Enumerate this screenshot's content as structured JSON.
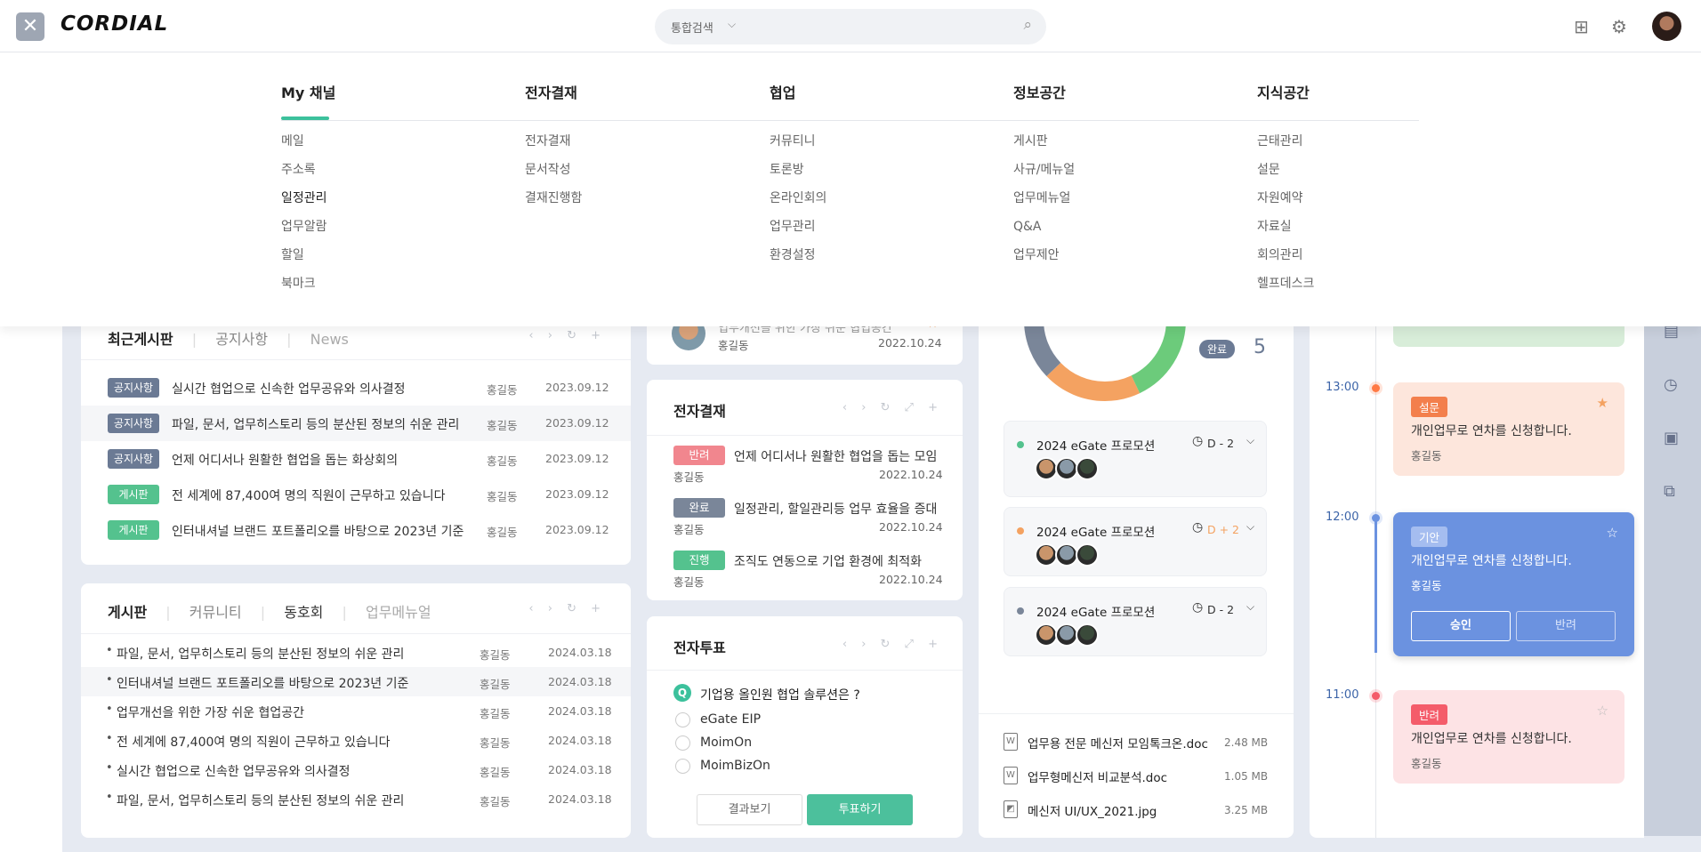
{
  "header": {
    "close_icon": "✕",
    "logo": "CORDIAL",
    "search_scope": "통합검색",
    "search_placeholder": ""
  },
  "menu": [
    {
      "title": "My 채널",
      "items": [
        "메일",
        "주소록",
        "일정관리",
        "업무알람",
        "할일",
        "북마크"
      ]
    },
    {
      "title": "전자결재",
      "items": [
        "전자결재",
        "문서작성",
        "결재진행함"
      ]
    },
    {
      "title": "협업",
      "items": [
        "커뮤티니",
        "토론방",
        "온라인회의",
        "업무관리",
        "환경설정"
      ]
    },
    {
      "title": "정보공간",
      "items": [
        "게시판",
        "사규/메뉴얼",
        "업무메뉴얼",
        "Q&A",
        "업무제안"
      ]
    },
    {
      "title": "지식공간",
      "items": [
        "근태관리",
        "설문",
        "자원예약",
        "자료실",
        "회의관리",
        "헬프데스크"
      ]
    }
  ],
  "recent": {
    "tabs": [
      "최근게시판",
      "공지사항",
      "News"
    ],
    "rows": [
      {
        "badge": "공지사항",
        "type": "notice",
        "title": "실시간 협업으로 신속한 업무공유와 의사결정",
        "author": "홍길동",
        "date": "2023.09.12"
      },
      {
        "badge": "공지사항",
        "type": "notice",
        "title": "파일, 문서, 업무히스토리 등의 분산된 정보의 쉬운 관리",
        "author": "홍길동",
        "date": "2023.09.12"
      },
      {
        "badge": "공지사항",
        "type": "notice",
        "title": "언제 어디서나 원활한 협업을 돕는 화상회의",
        "author": "홍길동",
        "date": "2023.09.12"
      },
      {
        "badge": "게시판",
        "type": "board",
        "title": "전 세계에 87,400여 명의 직원이 근무하고 있습니다",
        "author": "홍길동",
        "date": "2023.09.12"
      },
      {
        "badge": "게시판",
        "type": "board",
        "title": "인터내셔널 브랜드 포트폴리오를 바탕으로 2023년 기준",
        "author": "홍길동",
        "date": "2023.09.12"
      }
    ]
  },
  "board": {
    "tabs": [
      "게시판",
      "커뮤니티",
      "동호회",
      "업무메뉴얼"
    ],
    "rows": [
      {
        "title": "파일, 문서, 업무히스토리 등의 분산된 정보의 쉬운 관리",
        "author": "홍길동",
        "date": "2024.03.18"
      },
      {
        "title": "인터내셔널 브랜드 포트폴리오를 바탕으로 2023년 기준",
        "author": "홍길동",
        "date": "2024.03.18"
      },
      {
        "title": "업무개선을 위한 가장 쉬운 협업공간",
        "author": "홍길동",
        "date": "2024.03.18"
      },
      {
        "title": "전 세계에 87,400여 명의 직원이 근무하고 있습니다",
        "author": "홍길동",
        "date": "2024.03.18"
      },
      {
        "title": "실시간 협업으로 신속한 업무공유와 의사결정",
        "author": "홍길동",
        "date": "2024.03.18"
      },
      {
        "title": "파일, 문서, 업무히스토리 등의 분산된 정보의 쉬운 관리",
        "author": "홍길동",
        "date": "2024.03.18"
      }
    ]
  },
  "top_item": {
    "title": "업무개선을 위한 가장 쉬운 협업공간",
    "author": "홍길동",
    "date": "2022.10.24"
  },
  "approval": {
    "title": "전자결재",
    "rows": [
      {
        "badge": "반려",
        "color": "#f1868e",
        "title": "언제 어디서나 원활한 협업을 돕는 모임",
        "author": "홍길동",
        "date": "2022.10.24"
      },
      {
        "badge": "완료",
        "color": "#7a8699",
        "title": "일정관리, 할일관리등 업무 효율을 증대",
        "author": "홍길동",
        "date": "2022.10.24"
      },
      {
        "badge": "진행",
        "color": "#54c28e",
        "title": "조직도 연동으로 기업 환경에 최적화",
        "author": "홍길동",
        "date": "2022.10.24"
      }
    ]
  },
  "vote": {
    "title": "전자투표",
    "q": "Q",
    "question": "기업용 올인원 협업 솔루션은 ?",
    "options": [
      "eGate EIP",
      "MoimOn",
      "MoimBizOn"
    ],
    "result_btn": "결과보기",
    "vote_btn": "투표하기"
  },
  "progress": {
    "done_label": "완료",
    "done_count": "5",
    "projects": [
      {
        "name": "2024 eGate 프로모션",
        "dot": "#54c28e",
        "dday": "D - 2",
        "dday_color": "#333"
      },
      {
        "name": "2024 eGate 프로모션",
        "dot": "#f4a261",
        "dday": "D + 2",
        "dday_color": "#f4a261"
      },
      {
        "name": "2024 eGate 프로모션",
        "dot": "#7a8699",
        "dday": "D - 2",
        "dday_color": "#333"
      }
    ]
  },
  "files": [
    {
      "name": "업무용 전문 메신저 모임톡크온.doc",
      "size": "2.48 MB"
    },
    {
      "name": "업무형메신저 비교분석.doc",
      "size": "1.05 MB"
    },
    {
      "name": "메신저 UI/UX_2021.jpg",
      "size": "3.25 MB"
    }
  ],
  "timeline": [
    {
      "time": "13:00",
      "tag": "설문",
      "text": "개인업무로 연차를 신청합니다.",
      "author": "홍길동"
    },
    {
      "time": "12:00",
      "tag": "기안",
      "text": "개인업무로 연차를 신청합니다.",
      "author": "홍길동",
      "approve": "승인",
      "reject": "반려"
    },
    {
      "time": "11:00",
      "tag": "반려",
      "text": "개인업무로 연차를 신청합니다.",
      "author": "홍길동"
    }
  ],
  "colors": {
    "accent": "#3cc19c",
    "notice_badge": "#6b7a94",
    "board_badge": "#54c28e"
  }
}
